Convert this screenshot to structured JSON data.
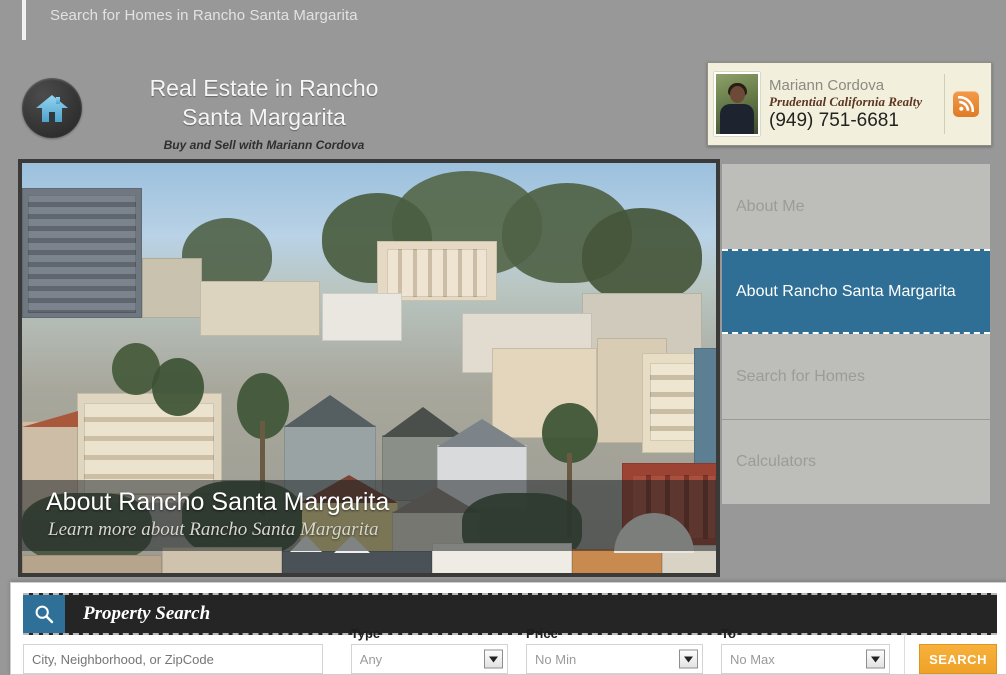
{
  "topbar": {
    "title": "Search for Homes in Rancho Santa Margarita"
  },
  "brand": {
    "logo_icon": "house-icon",
    "title_line1": "Real Estate in Rancho",
    "title_line2": "Santa Margarita",
    "tagline": "Buy and Sell with Mariann Cordova"
  },
  "agent_card": {
    "photo_alt": "agent-photo",
    "name": "Mariann Cordova",
    "company": "Prudential California Realty",
    "phone": "(949) 751-6681",
    "rss_icon": "rss-icon"
  },
  "hero": {
    "title": "About Rancho Santa Margarita",
    "subtitle": "Learn more about Rancho Santa Margarita"
  },
  "nav": {
    "items": [
      {
        "label": "About Me",
        "active": false
      },
      {
        "label": "About Rancho Santa Margarita",
        "active": true
      },
      {
        "label": "Search for Homes",
        "active": false
      },
      {
        "label": "Calculators",
        "active": false
      }
    ]
  },
  "search_panel": {
    "header_icon": "magnifier-icon",
    "header_title": "Property Search",
    "location": {
      "placeholder": "City, Neighborhood, or ZipCode",
      "value": ""
    },
    "type": {
      "label": "Type",
      "value": "Any"
    },
    "price": {
      "label": "Price",
      "value": "No Min"
    },
    "to": {
      "label": "To",
      "value": "No Max"
    },
    "submit_label": "SEARCH"
  },
  "colors": {
    "page_background": "#989898",
    "nav_active": "#2f6f96",
    "accent_orange": "#efa227",
    "search_header": "#252525",
    "card_background": "#f2f0dd"
  }
}
